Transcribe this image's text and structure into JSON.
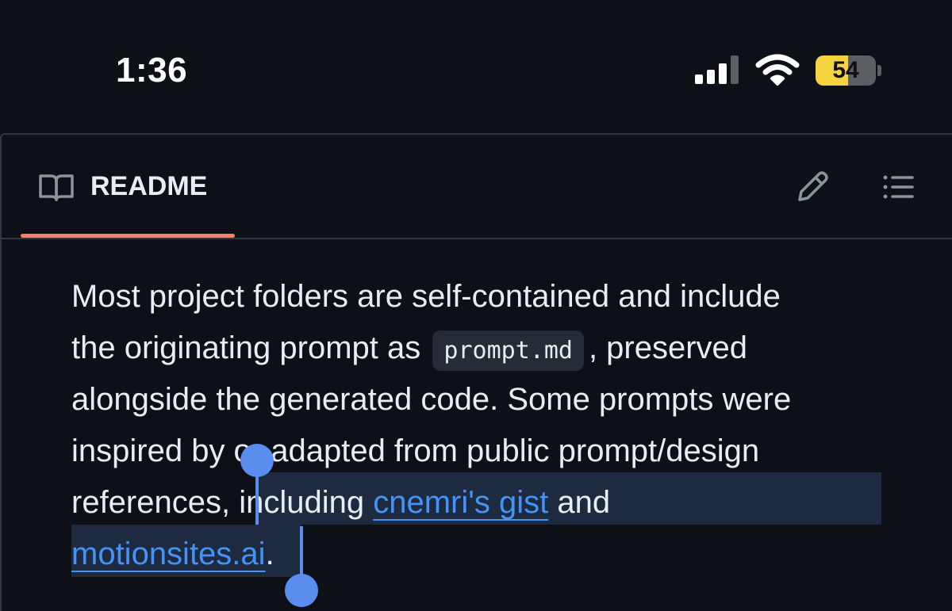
{
  "status_bar": {
    "time": "1:36",
    "battery_percent": "54",
    "battery_level": 0.54,
    "signal_bars_filled": 3,
    "signal_bars_total": 4,
    "icons": [
      "signal-icon",
      "wifi-icon",
      "battery-icon"
    ]
  },
  "readme": {
    "title": "README",
    "icons": [
      "book-icon",
      "pencil-icon",
      "list-icon"
    ],
    "accent_color": "#f78166"
  },
  "paragraph": {
    "l1": "Most project folders are self-contained and include",
    "l2_before": "the originating prompt as",
    "l2_code": "prompt.md",
    "l2_after": ", preserved",
    "l3": "alongside the generated code. Some prompts were",
    "l4": "inspired by or adapted from public prompt/design",
    "l5_before": "references,",
    "l5_sel": " including ",
    "l5_link": "cnemri's gist",
    "l5_after": " and",
    "l6_link": "motionsites.ai",
    "l6_after": "."
  },
  "colors": {
    "background": "#0d1117",
    "link": "#4493f8",
    "selection_handle": "#5b8def",
    "battery_fill": "#f5d33f"
  }
}
